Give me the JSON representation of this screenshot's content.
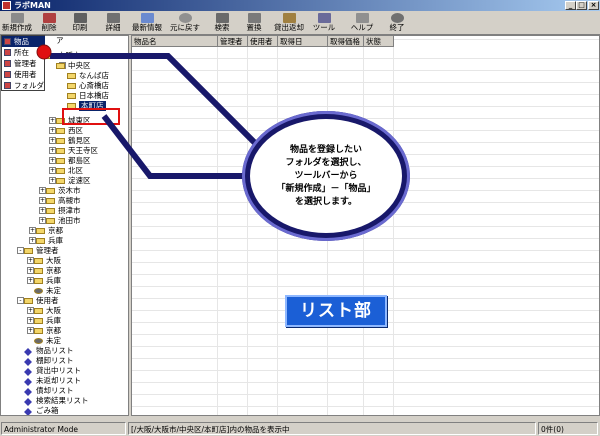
{
  "window": {
    "title": "ラボMAN"
  },
  "toolbar": [
    {
      "label": "新規作成",
      "icon": "new-icon"
    },
    {
      "label": "削除",
      "icon": "delete-icon"
    },
    {
      "label": "印刷",
      "icon": "print-icon"
    },
    {
      "label": "詳細",
      "icon": "detail-icon"
    },
    {
      "label": "最新情報",
      "icon": "refresh-icon"
    },
    {
      "label": "元に戻す",
      "icon": "undo-icon"
    },
    {
      "label": "検索",
      "icon": "search-icon"
    },
    {
      "label": "置換",
      "icon": "replace-icon"
    },
    {
      "label": "貸出返却",
      "icon": "lend-icon"
    },
    {
      "label": "ツール",
      "icon": "tool-icon"
    },
    {
      "label": "ヘルプ",
      "icon": "help-icon"
    },
    {
      "label": "終了",
      "icon": "exit-icon"
    }
  ],
  "popup_menu": [
    "物品",
    "所在",
    "管理者",
    "使用者",
    "フォルダ"
  ],
  "tree": {
    "partial_top": "ア",
    "nodes": [
      {
        "label": "大阪市"
      },
      {
        "label": "中央区"
      },
      {
        "label": "なんば店"
      },
      {
        "label": "心斎橋店"
      },
      {
        "label": "日本橋店"
      },
      {
        "label": "本町店"
      },
      {
        "label": "城東区"
      },
      {
        "label": "西区"
      },
      {
        "label": "鶴見区"
      },
      {
        "label": "天王寺区"
      },
      {
        "label": "都島区"
      },
      {
        "label": "北区"
      },
      {
        "label": "淀速区"
      },
      {
        "label": "茨木市"
      },
      {
        "label": "高槻市"
      },
      {
        "label": "摂津市"
      },
      {
        "label": "池田市"
      },
      {
        "label": "京都"
      },
      {
        "label": "兵庫"
      },
      {
        "label": "管理者"
      },
      {
        "label": "大阪"
      },
      {
        "label": "京都"
      },
      {
        "label": "兵庫"
      },
      {
        "label": "未定"
      },
      {
        "label": "使用者"
      },
      {
        "label": "大阪"
      },
      {
        "label": "兵庫"
      },
      {
        "label": "京都"
      },
      {
        "label": "未定"
      },
      {
        "label": "物品リスト"
      },
      {
        "label": "棚卸リスト"
      },
      {
        "label": "貸出中リスト"
      },
      {
        "label": "未返却リスト"
      },
      {
        "label": "債却リスト"
      },
      {
        "label": "検索結果リスト"
      },
      {
        "label": "ごみ箱"
      }
    ]
  },
  "list": {
    "columns": [
      "物品名",
      "管理者",
      "使用者",
      "取得日",
      "取得価格",
      "状態"
    ]
  },
  "callout": {
    "lines": [
      "物品を登録したい",
      "フォルダを選択し、",
      "ツールバーから",
      "「新規作成」－「物品」",
      "を選択します。"
    ]
  },
  "badge": {
    "label": "リスト部"
  },
  "statusbar": {
    "mode": "Administrator Mode",
    "message": "[/大阪/大阪市/中央区/本町店]内の物品を表示中",
    "count": "0件(0)"
  },
  "colors": {
    "callout_border": "#18186a",
    "badge": "#1b5fd6",
    "highlight": "#e01010"
  }
}
